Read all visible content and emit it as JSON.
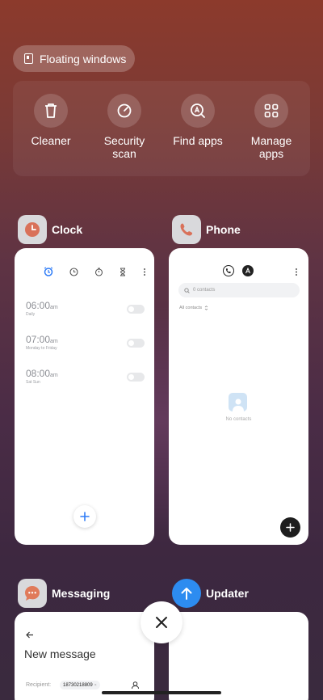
{
  "floating_windows": {
    "label": "Floating windows",
    "icon": "floating-window-icon"
  },
  "tools": [
    {
      "label": "Cleaner",
      "icon": "trash-icon"
    },
    {
      "label": "Security\nscan",
      "icon": "security-scan-icon"
    },
    {
      "label": "Find apps",
      "icon": "find-apps-icon"
    },
    {
      "label": "Manage\napps",
      "icon": "grid-icon"
    }
  ],
  "apps": {
    "clock": {
      "name": "Clock",
      "alarms": [
        {
          "time": "06:00",
          "ampm": "am",
          "repeat": "Daily"
        },
        {
          "time": "07:00",
          "ampm": "am",
          "repeat": "Monday to Friday"
        },
        {
          "time": "08:00",
          "ampm": "am",
          "repeat": "Sat Sun"
        }
      ]
    },
    "phone": {
      "name": "Phone",
      "search_placeholder": "0 contacts",
      "filter": "All contacts",
      "empty": "No contacts"
    },
    "messaging": {
      "name": "Messaging",
      "title": "New message",
      "recipient_label": "Recipient:",
      "recipient_value": "18730218809"
    },
    "updater": {
      "name": "Updater"
    }
  },
  "colors": {
    "clock_accent": "#2f7cf6",
    "phone_accent": "#e07a5a",
    "messaging_accent": "#e07a5a",
    "updater_accent": "#2d8cf0"
  }
}
